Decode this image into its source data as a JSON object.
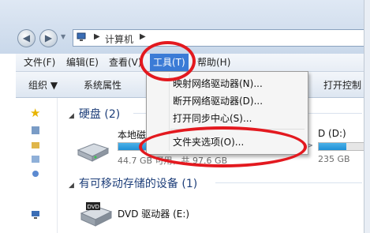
{
  "address": {
    "location": "计算机",
    "separator": "▶"
  },
  "menubar": {
    "items": [
      {
        "label": "文件(F)"
      },
      {
        "label": "编辑(E)"
      },
      {
        "label": "查看(V)"
      },
      {
        "label": "工具(T)"
      },
      {
        "label": "帮助(H)"
      }
    ]
  },
  "toolbar": {
    "organize": "组织 ▼",
    "system_properties": "系统属性",
    "open_control": "打开控制"
  },
  "tools_menu": {
    "items": [
      {
        "label": "映射网络驱动器(N)..."
      },
      {
        "label": "断开网络驱动器(D)..."
      },
      {
        "label": "打开同步中心(S)..."
      },
      {
        "label": "文件夹选项(O)..."
      }
    ]
  },
  "content": {
    "hard_disks_group": "硬盘 (2)",
    "local_disk_name": "本地磁",
    "local_disk_space": "44.7 GB 可用，共 97.6 GB",
    "local_disk_used_fraction": 0.54,
    "d_drive_name": "D (D:)",
    "d_drive_space": "235 GB",
    "d_drive_used_fraction": 0.6,
    "removable_group": "有可移动存储的设备 (1)",
    "dvd_name": "DVD 驱动器 (E:)"
  },
  "colors": {
    "highlight_ring": "#e3191f",
    "active_menu": "#3b7bd6",
    "group_heading": "#1e3f7a"
  }
}
